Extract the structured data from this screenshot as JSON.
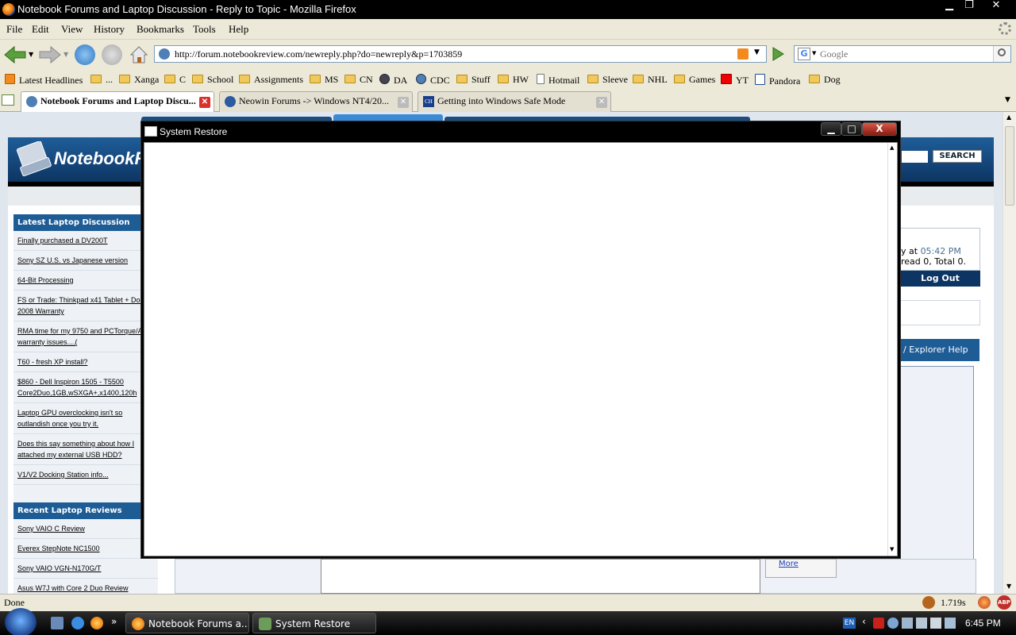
{
  "window": {
    "title": "Notebook Forums and Laptop Discussion - Reply to Topic - Mozilla Firefox",
    "minimize": "▁",
    "restore": "❐",
    "close": "✕"
  },
  "menubar": {
    "items": [
      {
        "label": "File"
      },
      {
        "label": "Edit"
      },
      {
        "label": "View"
      },
      {
        "label": "History"
      },
      {
        "label": "Bookmarks"
      },
      {
        "label": "Tools"
      },
      {
        "label": "Help"
      }
    ]
  },
  "navbar": {
    "url": "http://forum.notebookreview.com/newreply.php?do=newreply&p=1703859",
    "search_placeholder": "Google"
  },
  "bookmarks": [
    {
      "label": "Latest Headlines",
      "icon": "rss-icon"
    },
    {
      "label": "...",
      "icon": "folder-icon"
    },
    {
      "label": "Xanga",
      "icon": "folder-icon"
    },
    {
      "label": "C",
      "icon": "folder-icon"
    },
    {
      "label": "School",
      "icon": "folder-icon"
    },
    {
      "label": "Assignments",
      "icon": "folder-icon"
    },
    {
      "label": "MS",
      "icon": "folder-icon"
    },
    {
      "label": "CN",
      "icon": "folder-icon"
    },
    {
      "label": "DA",
      "icon": "da-icon"
    },
    {
      "label": "CDC",
      "icon": "globe-icon"
    },
    {
      "label": "Stuff",
      "icon": "folder-icon"
    },
    {
      "label": "HW",
      "icon": "folder-icon"
    },
    {
      "label": "Hotmail",
      "icon": "page-icon"
    },
    {
      "label": "Sleeve",
      "icon": "folder-icon"
    },
    {
      "label": "NHL",
      "icon": "folder-icon"
    },
    {
      "label": "Games",
      "icon": "folder-icon"
    },
    {
      "label": "YT",
      "icon": "youtube-icon"
    },
    {
      "label": "Pandora",
      "icon": "pandora-icon"
    },
    {
      "label": "Dog",
      "icon": "folder-icon"
    }
  ],
  "tabs": [
    {
      "label": "Notebook Forums and Laptop Discu...",
      "active": true
    },
    {
      "label": "Neowin Forums -> Windows NT4/20...",
      "active": false
    },
    {
      "label": "Getting into Windows Safe Mode",
      "active": false
    }
  ],
  "page": {
    "logo_text": "NotebookR",
    "search_button": "SEARCH",
    "login_line1": "y at",
    "login_time": "05:42 PM",
    "login_line2": "read 0, Total 0.",
    "logout": "Log Out",
    "explorer_help": "/ Explorer Help",
    "more_link": "More",
    "latest_head": "Latest Laptop Discussion",
    "latest_links": [
      "Finally purchased a DV200T",
      "Sony SZ U.S. vs Japanese version",
      "64-Bit Processing",
      "FS or Trade: Thinkpad x41 Tablet + Dock / 2008 Warranty",
      "RMA time for my 9750 and PCTorque/ATS warranty issues....(",
      "T60 - fresh XP install?",
      "$860 - Dell Inspiron 1505 - T5500 Core2Duo,1GB,wSXGA+,x1400,120h",
      "Laptop GPU overclocking isn't so outlandish once you try it.",
      "Does this say something about how I attached my external USB HDD?",
      "V1/V2 Docking Station info..."
    ],
    "reviews_head": "Recent Laptop Reviews",
    "review_links": [
      "Sony VAIO C Review",
      "Everex StepNote NC1500",
      "Sony VAIO VGN-N170G/T",
      "Asus W7J with Core 2 Duo Review"
    ]
  },
  "dialog": {
    "title": "System Restore",
    "minimize": "▁",
    "maximize": "□",
    "close": "X"
  },
  "statusbar": {
    "text": "Done",
    "timing": "1.719s",
    "abp": "ABP"
  },
  "taskbar": {
    "tasks": [
      {
        "label": "Notebook Forums a..."
      },
      {
        "label": "System Restore"
      }
    ],
    "lang": "EN",
    "clock": "6:45 PM"
  }
}
